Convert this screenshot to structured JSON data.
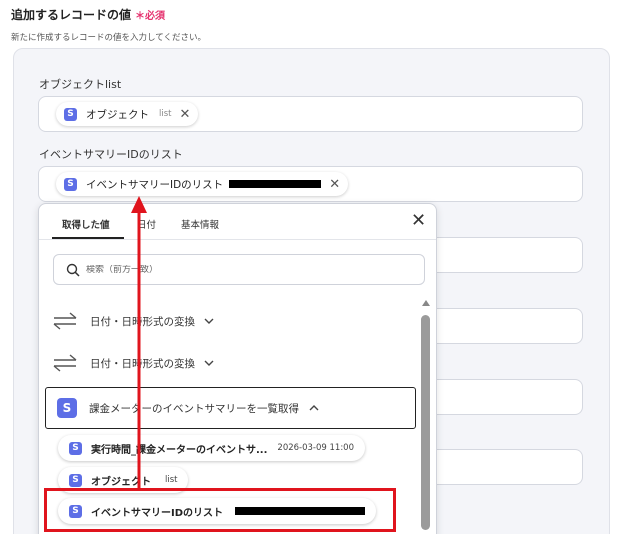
{
  "section": {
    "title": "追加するレコードの値",
    "required": "＊必須",
    "description": "新たに作成するレコードの値を入力してください。"
  },
  "fields": [
    {
      "label": "オブジェクトlist",
      "chip": {
        "label": "オブジェクト",
        "sub": "list"
      }
    },
    {
      "label": "イベントサマリーIDのリスト",
      "chip": {
        "label": "イベントサマリーIDのリスト"
      }
    }
  ],
  "dropdown": {
    "tabs": [
      "取得した値",
      "日付",
      "基本情報"
    ],
    "search_placeholder": "検索（前方一致）",
    "rows": [
      {
        "label": "日付・日時形式の変換",
        "icon": "swap-arrows-icon"
      },
      {
        "label": "日付・日時形式の変換",
        "icon": "swap-arrows-icon"
      }
    ],
    "group": {
      "label": "課金メーターのイベントサマリーを一覧取得"
    },
    "items": [
      {
        "label": "実行時間_課金メーターのイベントサ...",
        "value": "2026-03-09 11:00"
      },
      {
        "label": "オブジェクト",
        "value": "list"
      },
      {
        "label": "イベントサマリーIDのリスト"
      }
    ]
  },
  "colors": {
    "accent": "#5d6ee6",
    "required": "#e5336f",
    "annotation": "#e0141d"
  }
}
